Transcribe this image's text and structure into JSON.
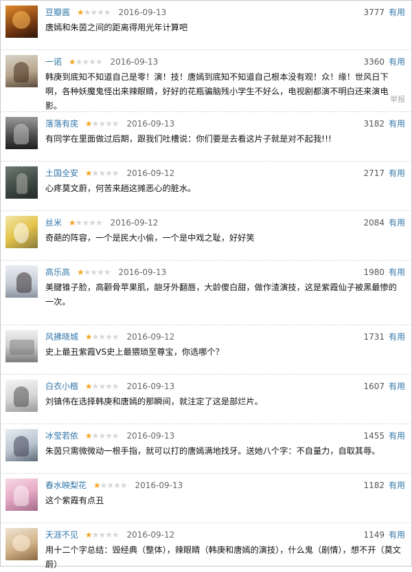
{
  "useful_label": "有用",
  "report_label": "举报",
  "star_color": "#f5a623",
  "link_color": "#3377aa",
  "comments": [
    {
      "username": "豆瓣酱",
      "rating": 1,
      "date": "2016-09-13",
      "votes": "3777",
      "text": "唐嫣和朱茵之间的距离得用光年计算吧",
      "avatar": "cartoon-cat-avatar"
    },
    {
      "username": "一诺",
      "rating": 1,
      "date": "2016-09-13",
      "votes": "3360",
      "text": "韩庚到底知不知道自己是零！演！技！唐嫣到底知不知道自己根本没有观！众！缘！世风日下啊，各种妖魔鬼怪出来辣眼睛，好好的花瓶骗脑残小学生不好么，电视剧都演不明白还来演电影。",
      "avatar": "woman-portrait-avatar"
    },
    {
      "username": "落落有庑",
      "rating": 1,
      "date": "2016-09-13",
      "votes": "3182",
      "text": "有同学在里面做过后期，跟我们吐槽说：你们要是去看这片子就是对不起我!!!",
      "avatar": "man-portrait-avatar"
    },
    {
      "username": "土国全安",
      "rating": 1,
      "date": "2016-09-12",
      "votes": "2717",
      "text": "心疼莫文蔚，何苦来趟这摊恶心的脏水。",
      "avatar": "statue-avatar"
    },
    {
      "username": "丝米",
      "rating": 1,
      "date": "2016-09-12",
      "votes": "2084",
      "text": "奇葩的阵容，一个是民大小偷，一个是中戏之耻，好好笑",
      "avatar": "flowers-avatar"
    },
    {
      "username": "高乐高",
      "rating": 1,
      "date": "2016-09-13",
      "votes": "1980",
      "text": "美腱锥子脸，高颧骨苹果肌，龅牙外翻唇，大龄傻白甜，做作渣演技，这是紫霞仙子被黑最惨的一次。",
      "avatar": "profile-silhouette-avatar"
    },
    {
      "username": "风拂晓城",
      "rating": 1,
      "date": "2016-09-12",
      "votes": "1731",
      "text": "史上最丑紫霞VS史上最猥琐至尊宝，你选哪个？",
      "avatar": "cartoon-faces-avatar"
    },
    {
      "username": "白衣小楷",
      "rating": 1,
      "date": "2016-09-13",
      "votes": "1607",
      "text": "刘镇伟在选择韩庚和唐嫣的那瞬间，就注定了这是部烂片。",
      "avatar": "drawn-girl-avatar"
    },
    {
      "username": "冰莹若依",
      "rating": 1,
      "date": "2016-09-13",
      "votes": "1455",
      "text": "朱茵只需微微动一根手指，就可以打的唐嫣满地找牙。送她八个字：不自量力，自取其辱。",
      "avatar": "anime-girl-avatar"
    },
    {
      "username": "春水映梨花",
      "rating": 1,
      "date": "2016-09-13",
      "votes": "1182",
      "text": "这个紫霞有点丑",
      "avatar": "pink-blossom-avatar"
    },
    {
      "username": "天涯不见",
      "rating": 1,
      "date": "2016-09-12",
      "votes": "1149",
      "text": "用十二个字总结：毁经典（整体），辣眼睛（韩庚和唐嫣的演技），什么鬼（剧情），想不开（莫文蔚）",
      "avatar": "cat-avatar"
    }
  ]
}
